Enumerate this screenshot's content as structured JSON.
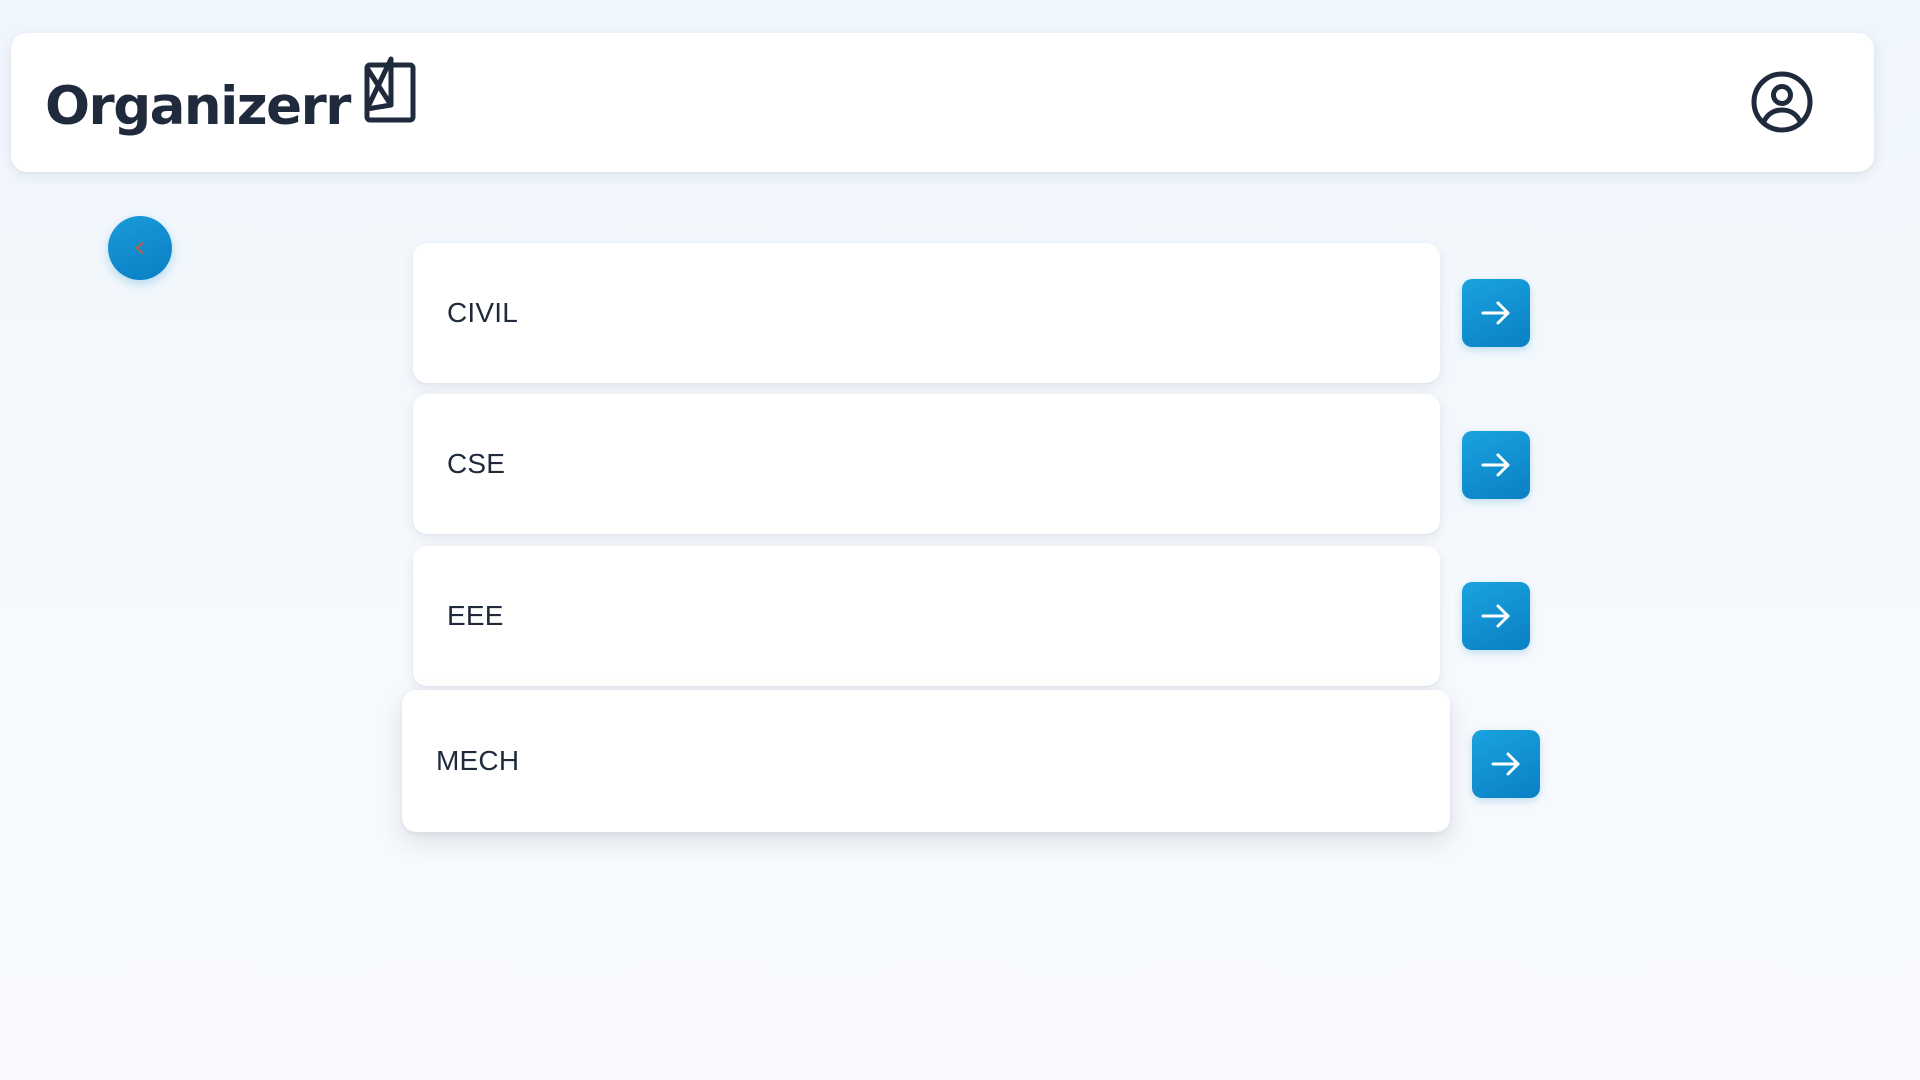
{
  "app": {
    "title": "Organizerr",
    "logo_icon": "book-icon",
    "profile_icon": "user-circle-icon"
  },
  "navigation": {
    "back_icon": "chevron-left-icon"
  },
  "departments": [
    {
      "label": "CIVIL",
      "action_icon": "arrow-right-icon"
    },
    {
      "label": "CSE",
      "action_icon": "arrow-right-icon"
    },
    {
      "label": "EEE",
      "action_icon": "arrow-right-icon"
    },
    {
      "label": "MECH",
      "action_icon": "arrow-right-icon"
    }
  ],
  "colors": {
    "accent": "#0a7fc4",
    "text": "#1f2a3c",
    "background": "#f1f6fc",
    "back_chevron": "#c0603a"
  }
}
